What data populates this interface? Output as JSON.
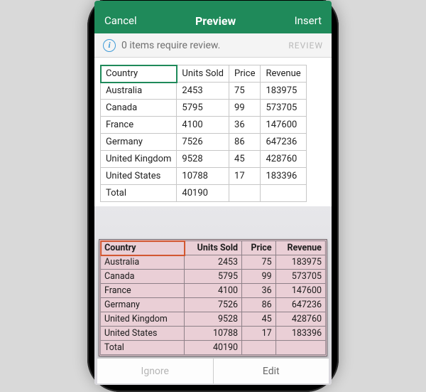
{
  "nav": {
    "cancel": "Cancel",
    "title": "Preview",
    "insert": "Insert"
  },
  "review": {
    "message": "0 items require review.",
    "button": "REVIEW"
  },
  "table": {
    "headers": [
      "Country",
      "Units Sold",
      "Price",
      "Revenue"
    ],
    "rows": [
      [
        "Australia",
        "2453",
        "75",
        "183975"
      ],
      [
        "Canada",
        "5795",
        "99",
        "573705"
      ],
      [
        "France",
        "4100",
        "36",
        "147600"
      ],
      [
        "Germany",
        "7526",
        "86",
        "647236"
      ],
      [
        "United Kingdom",
        "9528",
        "45",
        "428760"
      ],
      [
        "United States",
        "10788",
        "17",
        "183396"
      ],
      [
        "Total",
        "40190",
        "",
        ""
      ]
    ]
  },
  "photo_table": {
    "headers": [
      "Country",
      "Units Sold",
      "Price",
      "Revenue"
    ],
    "rows": [
      [
        "Australia",
        "2453",
        "75",
        "183975"
      ],
      [
        "Canada",
        "5795",
        "99",
        "573705"
      ],
      [
        "France",
        "4100",
        "36",
        "147600"
      ],
      [
        "Germany",
        "7526",
        "86",
        "647236"
      ],
      [
        "United Kingdom",
        "9528",
        "45",
        "428760"
      ],
      [
        "United States",
        "10788",
        "17",
        "183396"
      ],
      [
        "Total",
        "40190",
        "",
        ""
      ]
    ]
  },
  "bottom": {
    "ignore": "Ignore",
    "edit": "Edit"
  }
}
